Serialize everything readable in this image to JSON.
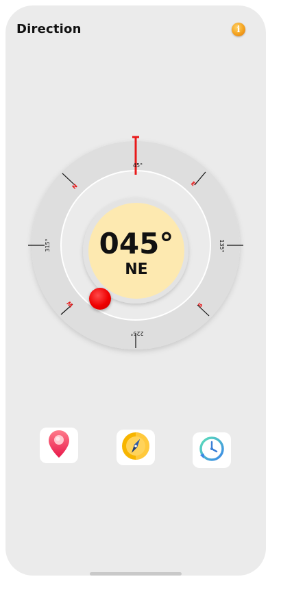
{
  "header": {
    "title": "Direction",
    "info_icon": "info-icon"
  },
  "compass": {
    "heading_degrees": "045°",
    "heading_direction": "NE",
    "dial_labels": {
      "top": "45°",
      "right": "135°",
      "bottom": "225°",
      "left": "315°"
    },
    "cardinals": {
      "north": "N",
      "east": "E",
      "south": "S",
      "west": "W"
    },
    "accent_color": "#e8191a",
    "center_color": "#fde9b0",
    "ring_color": "#dedede"
  },
  "tabs": [
    {
      "icon": "map-pin-icon"
    },
    {
      "icon": "compass-icon"
    },
    {
      "icon": "history-clock-icon"
    }
  ]
}
